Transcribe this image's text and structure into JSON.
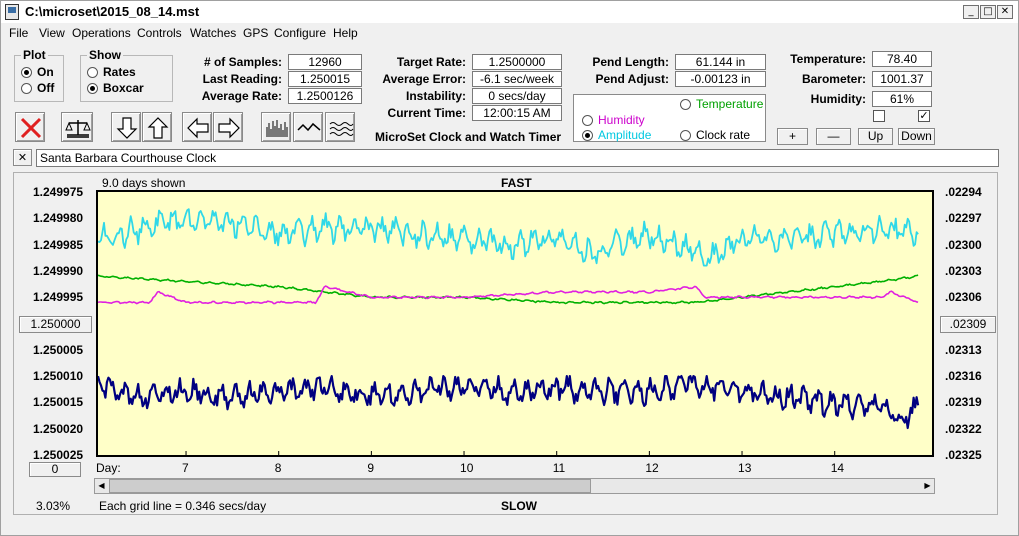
{
  "window": {
    "title": "C:\\microset\\2015_08_14.mst",
    "btn_minimize": "_",
    "btn_maximize": "□",
    "btn_close": "✕"
  },
  "menu": [
    "File",
    "View",
    "Operations",
    "Controls",
    "Watches",
    "GPS",
    "Configure",
    "Help"
  ],
  "plot_group": {
    "title": "Plot",
    "options": [
      {
        "label": "On",
        "selected": true
      },
      {
        "label": "Off",
        "selected": false
      }
    ]
  },
  "show_group": {
    "title": "Show",
    "options": [
      {
        "label": "Rates",
        "selected": false
      },
      {
        "label": "Boxcar",
        "selected": true
      }
    ]
  },
  "stats": {
    "samples_label": "# of Samples:",
    "samples": "12960",
    "last_reading_label": "Last Reading:",
    "last_reading": "1.250015",
    "average_rate_label": "Average Rate:",
    "average_rate": "1.2500126",
    "target_rate_label": "Target Rate:",
    "target_rate": "1.2500000",
    "average_error_label": "Average Error:",
    "average_error": "-6.1 sec/week",
    "instability_label": "Instability:",
    "instability": "0 secs/day",
    "current_time_label": "Current Time:",
    "current_time": "12:00:15 AM",
    "pend_length_label": "Pend Length:",
    "pend_length": "61.144 in",
    "pend_adjust_label": "Pend Adjust:",
    "pend_adjust": "-0.00123 in",
    "temperature_label": "Temperature:",
    "temperature": "78.40",
    "barometer_label": "Barometer:",
    "barometer": "1001.37",
    "humidity_label": "Humidity:",
    "humidity": "61%"
  },
  "app_caption": "MicroSet Clock and Watch Timer",
  "overlay_options": {
    "temperature": {
      "label": "Temperature",
      "selected": false,
      "color": "#00a000"
    },
    "humidity": {
      "label": "Humidity",
      "selected": false,
      "color": "#cc00cc"
    },
    "amplitude": {
      "label": "Amplitude",
      "selected": true,
      "color": "#00c8e0"
    },
    "clock_rate": {
      "label": "Clock rate",
      "selected": false,
      "color": "#000000"
    }
  },
  "checkboxes": [
    {
      "checked": false
    },
    {
      "checked": true
    }
  ],
  "scale_buttons": {
    "plus": "+",
    "minus": "—",
    "up": "Up",
    "down": "Down"
  },
  "clock_name": "Santa Barbara Courthouse Clock",
  "clock_name_close": "✕",
  "plot": {
    "days_shown": "9.0 days shown",
    "top_label": "FAST",
    "bottom_label": "SLOW",
    "center_left_button": "1.250000",
    "center_right_button": ".02309",
    "zero_button": "0",
    "percent": "3.03%",
    "grid_note": "Each grid line = 0.346 secs/day",
    "day_label": "Day:"
  },
  "chart_data": {
    "type": "line",
    "x_label": "Day:",
    "x_ticks": [
      "7",
      "8",
      "9",
      "10",
      "11",
      "12",
      "13",
      "14"
    ],
    "xlim": [
      6.05,
      15.05
    ],
    "left_axis": {
      "ticks": [
        "1.249975",
        "1.249980",
        "1.249985",
        "1.249990",
        "1.249995",
        "1.250000",
        "1.250005",
        "1.250010",
        "1.250015",
        "1.250020",
        "1.250025"
      ],
      "inverted": true,
      "range": [
        1.249975,
        1.250025
      ]
    },
    "right_axis": {
      "ticks": [
        ".02294",
        ".02297",
        ".02300",
        ".02303",
        ".02306",
        ".02309",
        ".02313",
        ".02316",
        ".02319",
        ".02322",
        ".02325"
      ]
    },
    "series": [
      {
        "name": "Clock rate",
        "color": "#000080",
        "x": [
          6.05,
          6.5,
          7.0,
          7.5,
          8.0,
          8.5,
          9.0,
          9.5,
          10.0,
          10.5,
          11.0,
          11.5,
          12.0,
          12.5,
          13.0,
          13.5,
          14.0,
          14.5,
          14.7,
          14.9
        ],
        "y": [
          1.250012,
          1.250014,
          1.250013,
          1.250014,
          1.250013,
          1.250012,
          1.250014,
          1.250013,
          1.250012,
          1.250013,
          1.250012,
          1.250013,
          1.250013,
          1.250011,
          1.250013,
          1.250014,
          1.250015,
          1.250016,
          1.250018,
          1.250016
        ],
        "y_min": 1.25001,
        "y_max": 1.25002,
        "noise": 2.5e-06
      },
      {
        "name": "Amplitude",
        "color": "#30d8e8",
        "x": [
          6.05,
          6.5,
          7.0,
          7.5,
          8.0,
          8.5,
          9.0,
          9.5,
          10.0,
          10.5,
          11.0,
          11.4,
          11.6,
          12.0,
          12.5,
          12.6,
          13.0,
          13.5,
          14.0,
          14.5,
          14.9
        ],
        "y": [
          1.249984,
          1.249982,
          1.24998,
          1.249981,
          1.249983,
          1.249982,
          1.249982,
          1.249983,
          1.249984,
          1.249985,
          1.249984,
          1.249987,
          1.249985,
          1.249983,
          1.249986,
          1.249988,
          1.249984,
          1.249984,
          1.249983,
          1.249982,
          1.249983
        ],
        "y_min": 1.249977,
        "y_max": 1.249989,
        "noise": 2.5e-06
      },
      {
        "name": "Temperature",
        "color": "#00b000",
        "x": [
          6.05,
          7.0,
          8.0,
          8.5,
          9.0,
          10.0,
          11.0,
          11.5,
          12.0,
          12.5,
          13.0,
          13.5,
          14.0,
          14.5,
          14.9
        ],
        "y": [
          1.249991,
          1.249992,
          1.249993,
          1.249994,
          1.249995,
          1.249995,
          1.249996,
          1.249996,
          1.249996,
          1.249996,
          1.249995,
          1.249994,
          1.249993,
          1.249992,
          1.249991
        ],
        "noise": 2e-07
      },
      {
        "name": "Humidity",
        "color": "#e020e0",
        "x": [
          6.05,
          6.6,
          6.7,
          7.0,
          8.0,
          8.4,
          8.5,
          9.0,
          10.0,
          11.0,
          11.5,
          12.0,
          12.5,
          12.6,
          13.0,
          14.0,
          14.5,
          14.6,
          14.9
        ],
        "y": [
          1.249996,
          1.249996,
          1.249994,
          1.249996,
          1.249996,
          1.249996,
          1.249993,
          1.249995,
          1.249995,
          1.249994,
          1.249994,
          1.249994,
          1.249993,
          1.249995,
          1.249995,
          1.249995,
          1.249995,
          1.249994,
          1.249996
        ],
        "noise": 2e-07
      }
    ]
  }
}
